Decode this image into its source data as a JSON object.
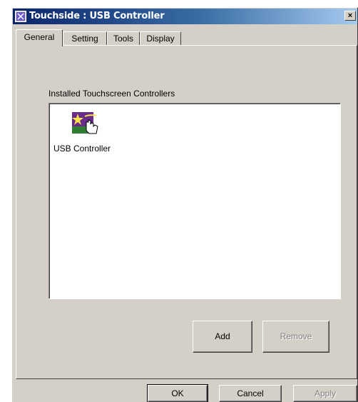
{
  "window": {
    "title": "Touchside : USB Controller",
    "close_label": "×"
  },
  "tabs": [
    {
      "label": "General",
      "active": true
    },
    {
      "label": "Setting",
      "active": false
    },
    {
      "label": "Tools",
      "active": false
    },
    {
      "label": "Display",
      "active": false
    }
  ],
  "general": {
    "list_label": "Installed Touchscreen Controllers",
    "items": [
      {
        "label": "USB Controller",
        "icon": "usb-controller-icon"
      }
    ],
    "add_label": "Add",
    "remove_label": "Remove"
  },
  "footer": {
    "ok_label": "OK",
    "cancel_label": "Cancel",
    "apply_label": "Apply"
  }
}
